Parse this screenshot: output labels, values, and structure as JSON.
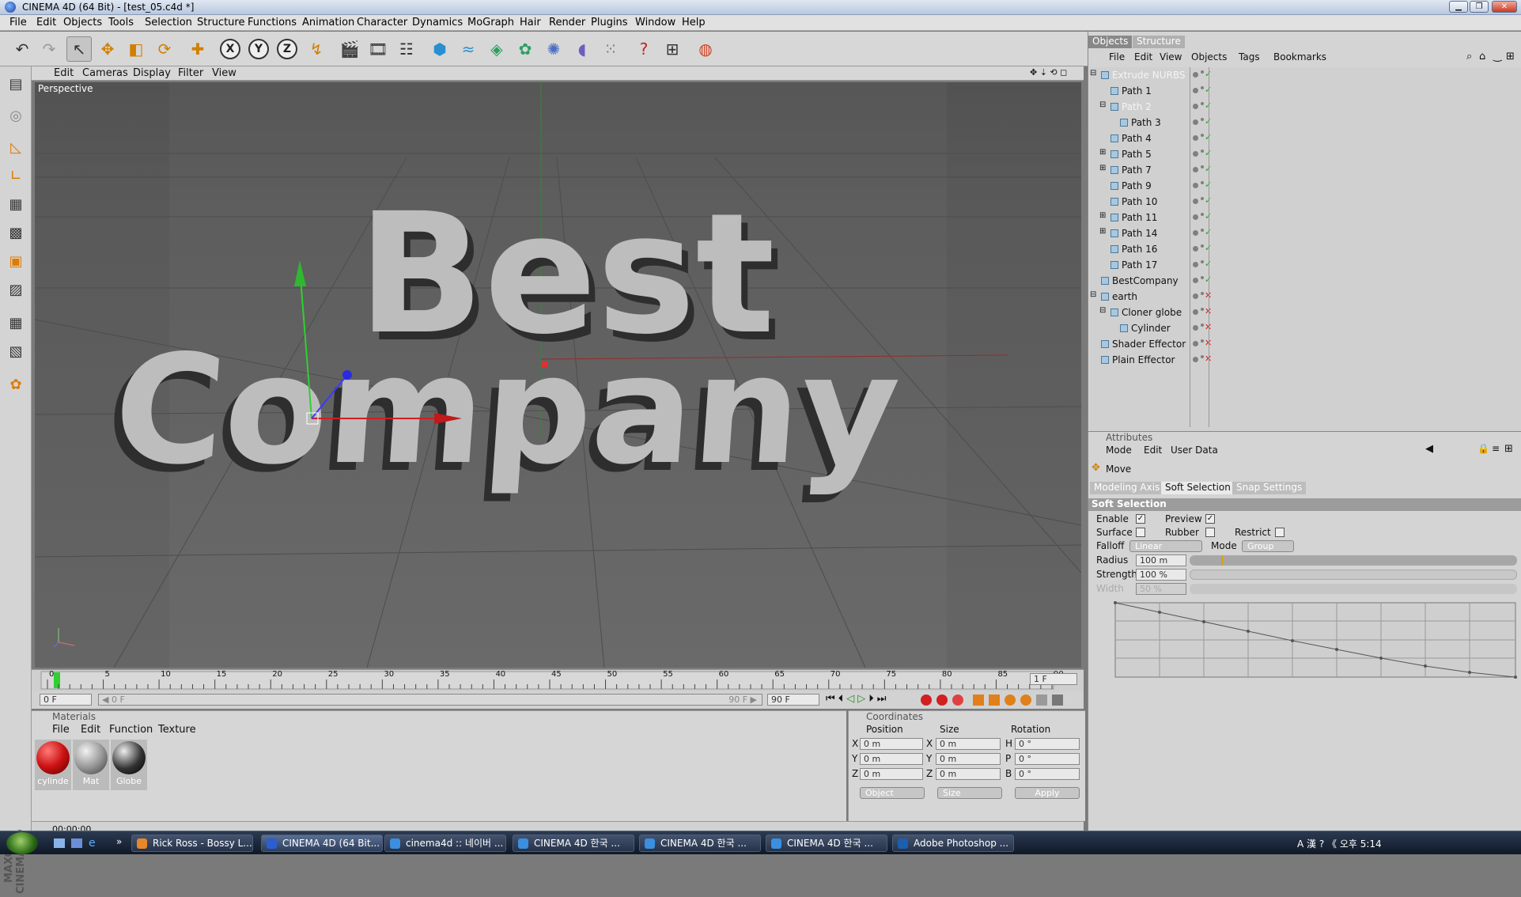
{
  "window": {
    "title": "CINEMA 4D (64 Bit) - [test_05.c4d *]",
    "min": "▁",
    "max": "❐",
    "close": "✕"
  },
  "menubar": [
    "File",
    "Edit",
    "Objects",
    "Tools",
    "Selection",
    "Structure",
    "Functions",
    "Animation",
    "Character",
    "Dynamics",
    "MoGraph",
    "Hair",
    "Render",
    "Plugins",
    "Window",
    "Help"
  ],
  "toolbar": {
    "undo": "↶",
    "redo": "↷",
    "live_select": "↖",
    "move": "✥",
    "scale": "◧",
    "rotate": "⟳",
    "model": "✚",
    "x_axis": "X",
    "y_axis": "Y",
    "z_axis": "Z",
    "coord": "↯",
    "render_view": "🎬",
    "render_pic": "🎞",
    "render_settings": "☷",
    "cube": "⬢",
    "spline": "≈",
    "nurbs": "◈",
    "array": "✿",
    "deformer": "✺",
    "scene": "◖",
    "particles": "⁙",
    "help": "?",
    "timeline": "⊞",
    "web": "◍"
  },
  "viewport": {
    "menu": [
      "Edit",
      "Cameras",
      "Display",
      "Filter",
      "View"
    ],
    "label": "Perspective",
    "text_line1": "Best",
    "text_line2": "Company",
    "nav_icons": "✥ ⇣ ⟲ ◻"
  },
  "timeline": {
    "ticks": [
      "0",
      "5",
      "10",
      "15",
      "20",
      "25",
      "30",
      "35",
      "40",
      "45",
      "50",
      "55",
      "60",
      "65",
      "70",
      "75",
      "80",
      "85",
      "90"
    ],
    "current_frame": "1 F",
    "start": "0 F",
    "range_start": "◀ 0 F",
    "range_end": "90 F ▶",
    "end": "90 F",
    "play": [
      "⏮",
      "⏴",
      "◁",
      "▷",
      "⏵",
      "⏭"
    ]
  },
  "materials": {
    "title": "Materials",
    "menu": [
      "File",
      "Edit",
      "Function",
      "Texture"
    ],
    "items": [
      {
        "label": "cylinde",
        "color": "#cc1111"
      },
      {
        "label": "Mat",
        "color": "#9a9a9a"
      },
      {
        "label": "Globe",
        "color": "#333333"
      }
    ]
  },
  "coordinates": {
    "title": "Coordinates",
    "headers": [
      "Position",
      "Size",
      "Rotation"
    ],
    "rows": [
      {
        "axis": "X",
        "pos": "0 m",
        "saxis": "X",
        "size": "0 m",
        "raxis": "H",
        "rot": "0 °"
      },
      {
        "axis": "Y",
        "pos": "0 m",
        "saxis": "Y",
        "size": "0 m",
        "raxis": "P",
        "rot": "0 °"
      },
      {
        "axis": "Z",
        "pos": "0 m",
        "saxis": "Z",
        "size": "0 m",
        "raxis": "B",
        "rot": "0 °"
      }
    ],
    "mode1": "Object",
    "mode2": "Size",
    "apply": "Apply"
  },
  "status": {
    "time": "00:00:00"
  },
  "objects_panel": {
    "tabs": [
      "Objects",
      "Structure"
    ],
    "menu": [
      "File",
      "Edit",
      "View",
      "Objects",
      "Tags",
      "Bookmarks"
    ],
    "items": [
      {
        "name": "Extrude NURBS",
        "indent": 0,
        "dim": true,
        "expand": "⊟",
        "tag": "orange"
      },
      {
        "name": "Path 1",
        "indent": 1,
        "dim": false,
        "expand": ""
      },
      {
        "name": "Path 2",
        "indent": 1,
        "dim": true,
        "expand": "⊟"
      },
      {
        "name": "Path 3",
        "indent": 2,
        "dim": false,
        "expand": ""
      },
      {
        "name": "Path 4",
        "indent": 1,
        "dim": false,
        "expand": ""
      },
      {
        "name": "Path 5",
        "indent": 1,
        "dim": false,
        "expand": "⊞"
      },
      {
        "name": "Path 7",
        "indent": 1,
        "dim": false,
        "expand": "⊞"
      },
      {
        "name": "Path 9",
        "indent": 1,
        "dim": false,
        "expand": ""
      },
      {
        "name": "Path 10",
        "indent": 1,
        "dim": false,
        "expand": ""
      },
      {
        "name": "Path 11",
        "indent": 1,
        "dim": false,
        "expand": "⊞"
      },
      {
        "name": "Path 14",
        "indent": 1,
        "dim": false,
        "expand": "⊞"
      },
      {
        "name": "Path 16",
        "indent": 1,
        "dim": false,
        "expand": ""
      },
      {
        "name": "Path 17",
        "indent": 1,
        "dim": false,
        "expand": ""
      },
      {
        "name": "BestCompany",
        "indent": 0,
        "dim": false,
        "expand": ""
      },
      {
        "name": "earth",
        "indent": 0,
        "dim": false,
        "expand": "⊟"
      },
      {
        "name": "Cloner globe",
        "indent": 1,
        "dim": false,
        "expand": "⊟"
      },
      {
        "name": "Cylinder",
        "indent": 2,
        "dim": false,
        "expand": ""
      },
      {
        "name": "Shader Effector",
        "indent": 0,
        "dim": false,
        "expand": ""
      },
      {
        "name": "Plain Effector",
        "indent": 0,
        "dim": false,
        "expand": ""
      }
    ]
  },
  "attributes": {
    "title": "Attributes",
    "menu": [
      "Mode",
      "Edit",
      "User Data"
    ],
    "tool": "Move",
    "tabs": [
      "Modeling Axis",
      "Soft Selection",
      "Snap Settings"
    ],
    "section": "Soft Selection",
    "enable": "Enable",
    "preview": "Preview",
    "surface": "Surface",
    "rubber": "Rubber",
    "restrict": "Restrict",
    "falloff_label": "Falloff",
    "falloff_value": "Linear",
    "mode_label": "Mode",
    "mode_value": "Group",
    "radius_label": "Radius",
    "radius_value": "100 m",
    "strength_label": "Strength",
    "strength_value": "100 %",
    "width_label": "Width",
    "width_value": "50 %"
  },
  "taskbar": {
    "items": [
      {
        "label": "Rick Ross - Bossy L...",
        "color": "#e8862a"
      },
      {
        "label": "CINEMA 4D (64 Bit...",
        "color": "#2b5fd1"
      },
      {
        "label": "cinema4d :: 네이버 ...",
        "color": "#3a8fe0"
      },
      {
        "label": "CINEMA 4D 한국 ...",
        "color": "#3a8fe0"
      },
      {
        "label": "CINEMA 4D 한국 ...",
        "color": "#3a8fe0"
      },
      {
        "label": "CINEMA 4D 한국 ...",
        "color": "#3a8fe0"
      },
      {
        "label": "Adobe Photoshop ...",
        "color": "#1b5fb0"
      }
    ],
    "tray": "A 漢 ? 《 오후 5:14"
  }
}
